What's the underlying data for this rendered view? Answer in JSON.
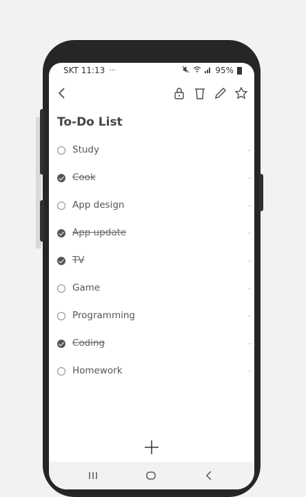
{
  "status_bar": {
    "carrier_time": "SKT 11:13",
    "more": "···",
    "battery_percent": "95%"
  },
  "app_bar": {
    "back_icon": "back-arrow-icon",
    "lock_icon": "lock-icon",
    "delete_icon": "trash-icon",
    "edit_icon": "pencil-icon",
    "favorite_icon": "star-icon"
  },
  "title": "To-Do List",
  "items": [
    {
      "label": "Study",
      "done": false
    },
    {
      "label": "Cook",
      "done": true
    },
    {
      "label": "App design",
      "done": false
    },
    {
      "label": "App update",
      "done": true
    },
    {
      "label": "TV",
      "done": true
    },
    {
      "label": "Game",
      "done": false
    },
    {
      "label": "Programming",
      "done": false
    },
    {
      "label": "Coding",
      "done": true
    },
    {
      "label": "Homework",
      "done": false
    }
  ],
  "add_icon": "plus-icon",
  "nav_bar": {
    "recents_icon": "recents-icon",
    "home_icon": "home-icon",
    "back_icon": "back-icon"
  }
}
